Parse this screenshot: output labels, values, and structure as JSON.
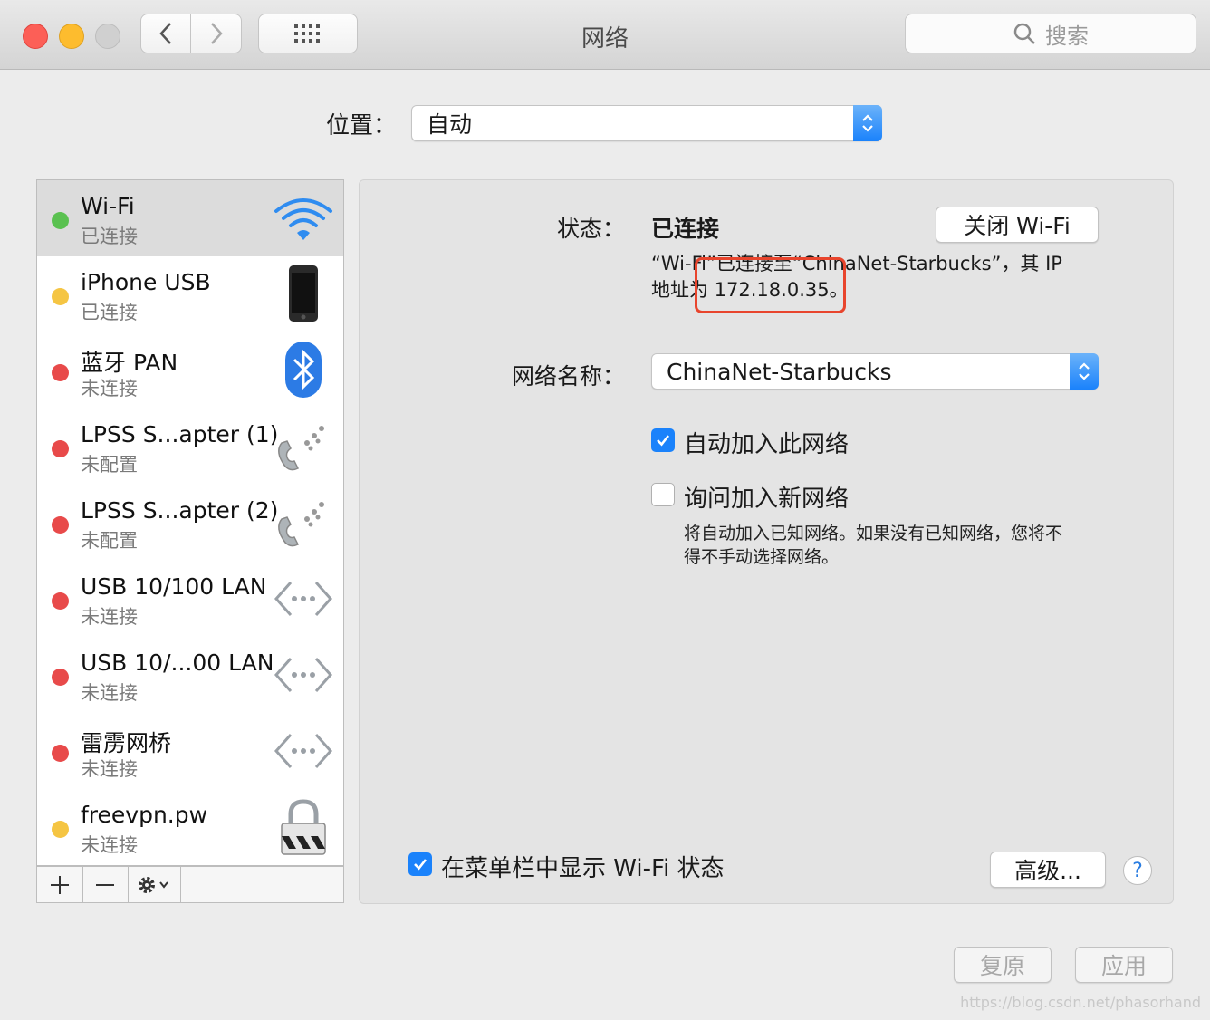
{
  "window": {
    "title": "网络"
  },
  "toolbar": {
    "search_placeholder": "搜索"
  },
  "location": {
    "label": "位置：",
    "value": "自动"
  },
  "services": [
    {
      "name": "Wi-Fi",
      "status": "已连接",
      "dot_color": "#5ac150",
      "icon": "wifi-icon",
      "selected": true
    },
    {
      "name": "iPhone USB",
      "status": "已连接",
      "dot_color": "#f5c543",
      "icon": "iphone-icon"
    },
    {
      "name": "蓝牙 PAN",
      "status": "未连接",
      "dot_color": "#e84a4a",
      "icon": "bluetooth-icon"
    },
    {
      "name": "LPSS S...apter (1)",
      "status": "未配置",
      "dot_color": "#e84a4a",
      "icon": "phone-modem-icon"
    },
    {
      "name": "LPSS S...apter (2)",
      "status": "未配置",
      "dot_color": "#e84a4a",
      "icon": "phone-modem-icon"
    },
    {
      "name": "USB 10/100 LAN",
      "status": "未连接",
      "dot_color": "#e84a4a",
      "icon": "ethernet-icon"
    },
    {
      "name": "USB 10/...00 LAN",
      "status": "未连接",
      "dot_color": "#e84a4a",
      "icon": "ethernet-icon"
    },
    {
      "name": "雷雳网桥",
      "status": "未连接",
      "dot_color": "#e84a4a",
      "icon": "ethernet-icon"
    },
    {
      "name": "freevpn.pw",
      "status": "未连接",
      "dot_color": "#f5c543",
      "icon": "vpn-lock-icon"
    }
  ],
  "detail": {
    "status_label": "状态：",
    "status_value": "已连接",
    "toggle_button": "关闭 Wi-Fi",
    "status_desc_line1": "“Wi-Fi”已连接至“ChinaNet-Starbucks”，其 IP",
    "status_desc_line2": "地址为 172.18.0.35。",
    "network_name_label": "网络名称：",
    "network_name_value": "ChinaNet-Starbucks",
    "auto_join_label": "自动加入此网络",
    "auto_join_checked": true,
    "ask_join_label": "询问加入新网络",
    "ask_join_checked": false,
    "ask_join_hint_line1": "将自动加入已知网络。如果没有已知网络，您将不",
    "ask_join_hint_line2": "得不手动选择网络。",
    "show_menubar_label": "在菜单栏中显示 Wi-Fi 状态",
    "show_menubar_checked": true,
    "advanced_button": "高级...",
    "help_button": "?"
  },
  "footer": {
    "revert_button": "复原",
    "apply_button": "应用"
  },
  "watermark": "https://blog.csdn.net/phasorhand",
  "colors": {
    "accent": "#1a82fb",
    "highlight_box": "#e8452d"
  }
}
